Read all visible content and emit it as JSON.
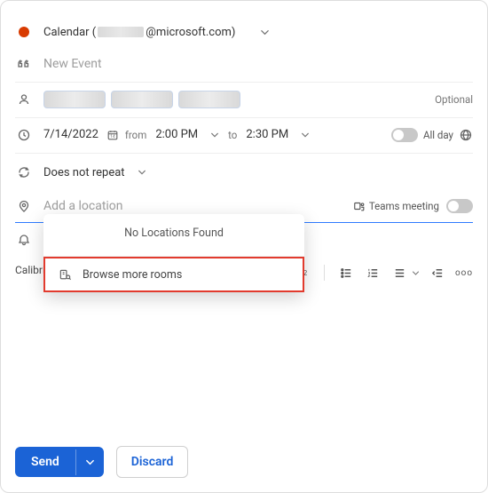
{
  "header": {
    "calendar_prefix": "Calendar (",
    "email_domain": "@microsoft.com)",
    "chev": "⌄"
  },
  "title": {
    "placeholder": "New Event"
  },
  "attendees": {
    "optional_label": "Optional"
  },
  "time": {
    "date": "7/14/2022",
    "from_label": "from",
    "start": "2:00 PM",
    "to_label": "to",
    "end": "2:30 PM",
    "allday_label": "All day"
  },
  "repeat": {
    "label": "Does not repeat"
  },
  "location": {
    "placeholder": "Add a location",
    "teams_label": "Teams meeting"
  },
  "location_dropdown": {
    "empty": "No Locations Found",
    "browse": "Browse more rooms"
  },
  "toolbar": {
    "font": "Calibri",
    "more": "ooo"
  },
  "footer": {
    "send": "Send",
    "discard": "Discard"
  }
}
